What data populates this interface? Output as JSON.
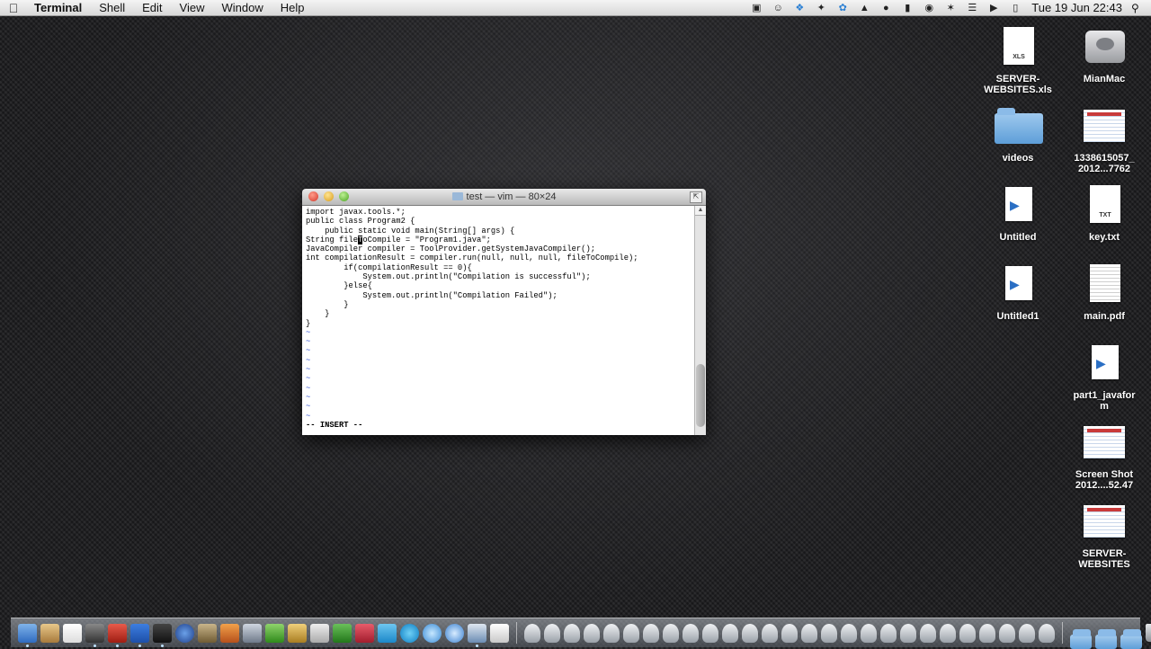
{
  "menubar": {
    "apple_symbol": "",
    "app_name": "Terminal",
    "menus": [
      "Shell",
      "Edit",
      "View",
      "Window",
      "Help"
    ],
    "clock": "Tue 19 Jun  22:43"
  },
  "desktop_icons": [
    {
      "label": "SERVER-\nWEBSITES.xls",
      "kind": "xls",
      "tag": "XLS"
    },
    {
      "label": "MianMac",
      "kind": "hdd"
    },
    {
      "label": "videos",
      "kind": "folder"
    },
    {
      "label": "1338615057_\n2012...7762",
      "kind": "sheet"
    },
    {
      "label": "Untitled",
      "kind": "movie"
    },
    {
      "label": "key.txt",
      "kind": "txt",
      "tag": "TXT"
    },
    {
      "label": "Untitled1",
      "kind": "movie"
    },
    {
      "label": "main.pdf",
      "kind": "pdf"
    },
    {
      "label": "part1_javafor\nm",
      "kind": "movie"
    },
    {
      "label": "Screen Shot\n2012....52.47",
      "kind": "sheet"
    },
    {
      "label": "SERVER-\nWEBSITES",
      "kind": "sheet"
    }
  ],
  "terminal": {
    "title": "test — vim — 80×24",
    "cursor_line": 3,
    "cursor_col": 11,
    "lines": [
      "import javax.tools.*;",
      "public class Program2 {",
      "    public static void main(String[] args) {",
      "String fileToCompile = \"Program1.java\";",
      "JavaCompiler compiler = ToolProvider.getSystemJavaCompiler();",
      "int compilationResult = compiler.run(null, null, null, fileToCompile);",
      "        if(compilationResult == 0){",
      "            System.out.println(\"Compilation is successful\");",
      "        }else{",
      "            System.out.println(\"Compilation Failed\");",
      "        }",
      "    }",
      "}"
    ],
    "empty_line_marker": "~",
    "empty_lines": 10,
    "mode_line": "-- INSERT --"
  }
}
